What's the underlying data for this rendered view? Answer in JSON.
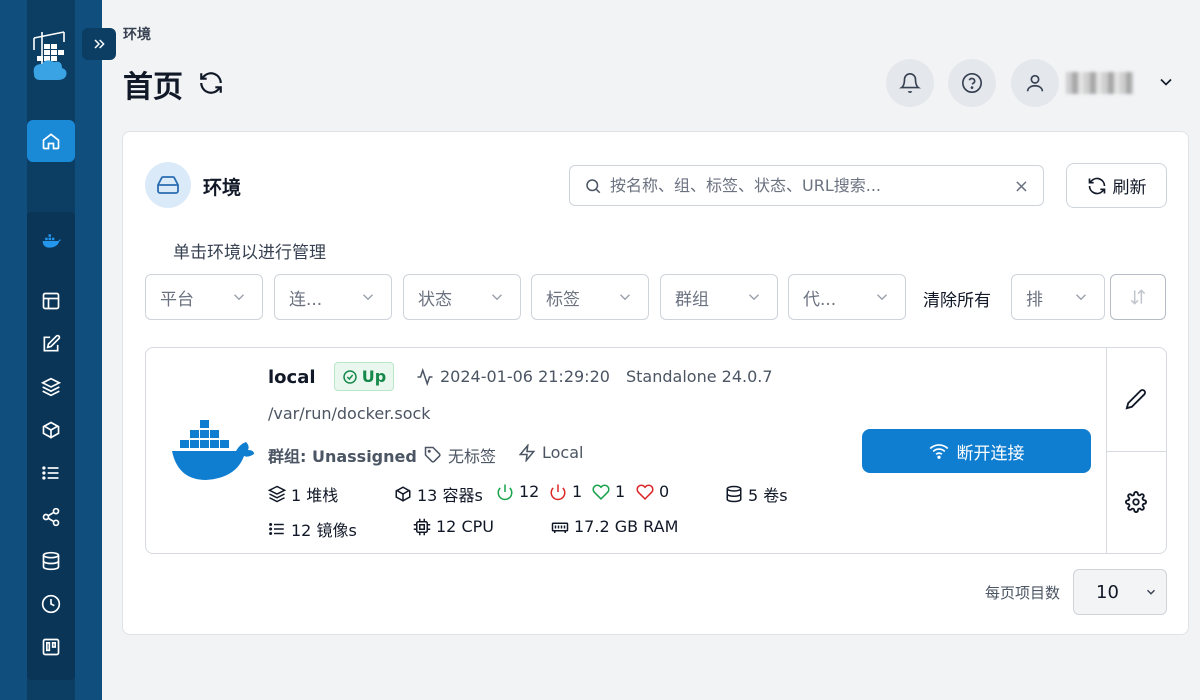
{
  "breadcrumb": "环境",
  "page_title": "首页",
  "header": {
    "username": ""
  },
  "environments_panel": {
    "title": "环境",
    "search_placeholder": "按名称、组、标签、状态、URL搜索...",
    "search_clear": "×",
    "refresh_label": "刷新",
    "hint": "单击环境以进行管理",
    "filters": [
      "平台",
      "连...",
      "状态",
      "标签",
      "群组",
      "代..."
    ],
    "clear_all": "清除所有",
    "sort_label": "排"
  },
  "environment": {
    "name": "local",
    "status": "Up",
    "last_check": "2024-01-06 21:29:20",
    "engine": "Standalone 24.0.7",
    "url": "/var/run/docker.sock",
    "group": "群组: Unassigned",
    "tags": "无标签",
    "type": "Local",
    "stats": {
      "stacks": "1 堆栈",
      "containers": "13 容器s",
      "running": "12",
      "stopped": "1",
      "healthy": "1",
      "unhealthy": "0",
      "volumes": "5 卷s",
      "images": "12 镜像s",
      "cpu": "12 CPU",
      "ram": "17.2 GB RAM"
    },
    "disconnect_label": "断开连接"
  },
  "pagination": {
    "label": "每页项目数",
    "value": "10"
  },
  "colors": {
    "sidebar": "#0f4e7d",
    "accent": "#0f7ed1",
    "status_up": "#16884a"
  }
}
